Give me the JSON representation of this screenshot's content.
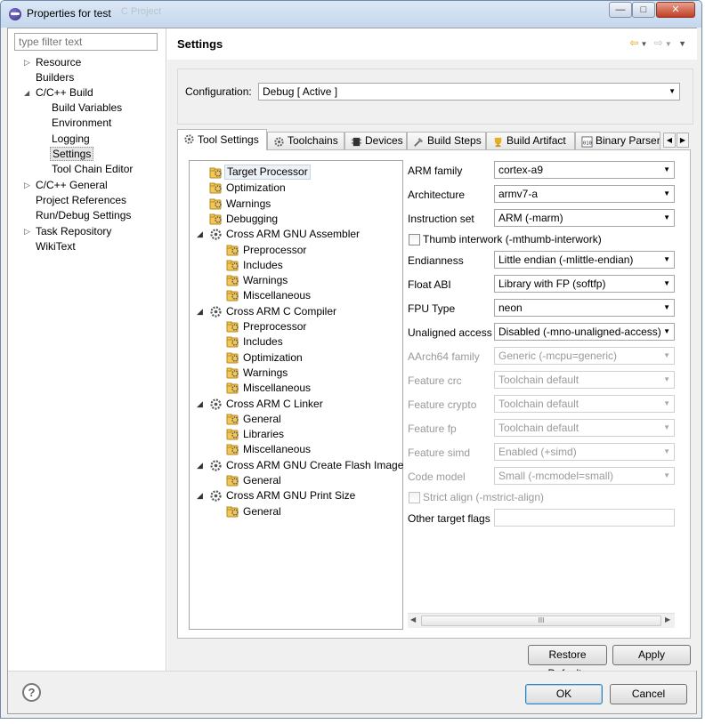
{
  "window": {
    "title": "Properties for test",
    "ghost_title": "C Project"
  },
  "filter": {
    "placeholder": "type filter text"
  },
  "nav": {
    "items": [
      {
        "label": "Resource"
      },
      {
        "label": "Builders"
      },
      {
        "label": "C/C++ Build"
      },
      {
        "label": "Build Variables"
      },
      {
        "label": "Environment"
      },
      {
        "label": "Logging"
      },
      {
        "label": "Settings"
      },
      {
        "label": "Tool Chain Editor"
      },
      {
        "label": "C/C++ General"
      },
      {
        "label": "Project References"
      },
      {
        "label": "Run/Debug Settings"
      },
      {
        "label": "Task Repository"
      },
      {
        "label": "WikiText"
      }
    ]
  },
  "page": {
    "title": "Settings"
  },
  "config": {
    "label": "Configuration:",
    "value": "Debug  [ Active ]"
  },
  "tabs": [
    {
      "label": "Tool Settings"
    },
    {
      "label": "Toolchains"
    },
    {
      "label": "Devices"
    },
    {
      "label": "Build Steps"
    },
    {
      "label": "Build Artifact"
    },
    {
      "label": "Binary Parser"
    }
  ],
  "tree": [
    {
      "label": "Target Processor"
    },
    {
      "label": "Optimization"
    },
    {
      "label": "Warnings"
    },
    {
      "label": "Debugging"
    },
    {
      "label": "Cross ARM GNU Assembler"
    },
    {
      "label": "Preprocessor"
    },
    {
      "label": "Includes"
    },
    {
      "label": "Warnings"
    },
    {
      "label": "Miscellaneous"
    },
    {
      "label": "Cross ARM C Compiler"
    },
    {
      "label": "Preprocessor"
    },
    {
      "label": "Includes"
    },
    {
      "label": "Optimization"
    },
    {
      "label": "Warnings"
    },
    {
      "label": "Miscellaneous"
    },
    {
      "label": "Cross ARM C Linker"
    },
    {
      "label": "General"
    },
    {
      "label": "Libraries"
    },
    {
      "label": "Miscellaneous"
    },
    {
      "label": "Cross ARM GNU Create Flash Image"
    },
    {
      "label": "General"
    },
    {
      "label": "Cross ARM GNU Print Size"
    },
    {
      "label": "General"
    }
  ],
  "form": {
    "arm_family": {
      "label": "ARM family",
      "value": "cortex-a9"
    },
    "architecture": {
      "label": "Architecture",
      "value": "armv7-a"
    },
    "instruction_set": {
      "label": "Instruction set",
      "value": "ARM (-marm)"
    },
    "thumb_interwork": {
      "label": "Thumb interwork (-mthumb-interwork)"
    },
    "endianness": {
      "label": "Endianness",
      "value": "Little endian (-mlittle-endian)"
    },
    "float_abi": {
      "label": "Float ABI",
      "value": "Library with FP (softfp)"
    },
    "fpu_type": {
      "label": "FPU Type",
      "value": "neon"
    },
    "unaligned_access": {
      "label": "Unaligned access",
      "value": "Disabled (-mno-unaligned-access)"
    },
    "aarch64_family": {
      "label": "AArch64 family",
      "value": "Generic (-mcpu=generic)"
    },
    "feature_crc": {
      "label": "Feature crc",
      "value": "Toolchain default"
    },
    "feature_crypto": {
      "label": "Feature crypto",
      "value": "Toolchain default"
    },
    "feature_fp": {
      "label": "Feature fp",
      "value": "Toolchain default"
    },
    "feature_simd": {
      "label": "Feature simd",
      "value": "Enabled (+simd)"
    },
    "code_model": {
      "label": "Code model",
      "value": "Small (-mcmodel=small)"
    },
    "strict_align": {
      "label": "Strict align (-mstrict-align)"
    },
    "other_flags": {
      "label": "Other target flags",
      "value": ""
    }
  },
  "buttons": {
    "restore": "Restore Defaults",
    "apply": "Apply",
    "ok": "OK",
    "cancel": "Cancel",
    "help": "?"
  },
  "scrollbar": {
    "thumb_grip": "III"
  }
}
